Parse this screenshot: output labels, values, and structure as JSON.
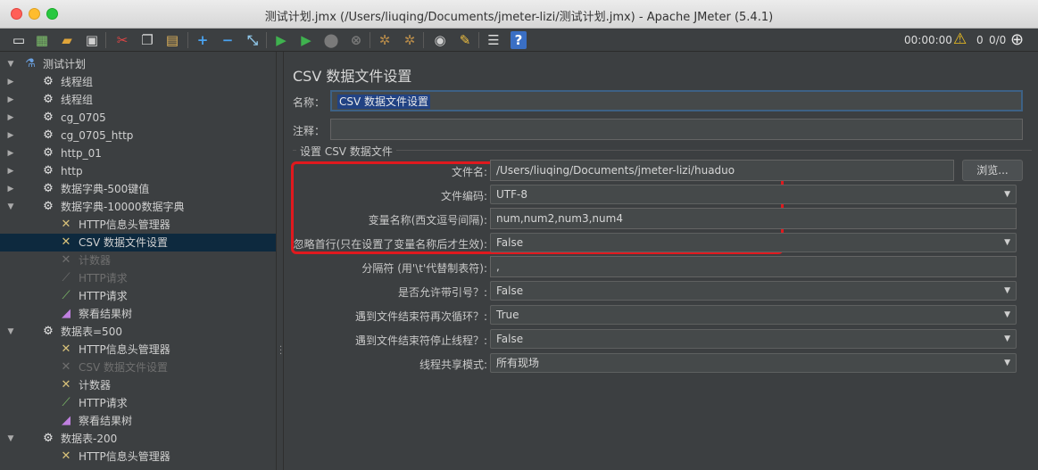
{
  "window": {
    "title": "测试计划.jmx (/Users/liuqing/Documents/jmeter-lizi/测试计划.jmx) - Apache JMeter (5.4.1)"
  },
  "toolbar": {
    "timer": "00:00:00",
    "warnings": "0",
    "threads": "0/0"
  },
  "tree": {
    "root": "测试计划",
    "nodes": [
      {
        "label": "线程组",
        "icon": "gear-icon"
      },
      {
        "label": "线程组",
        "icon": "gear-icon"
      },
      {
        "label": "cg_0705",
        "icon": "gear-icon"
      },
      {
        "label": "cg_0705_http",
        "icon": "gear-icon"
      },
      {
        "label": "http_01",
        "icon": "gear-icon"
      },
      {
        "label": "http",
        "icon": "gear-icon"
      },
      {
        "label": "数据字典-500键值",
        "icon": "gear-icon"
      },
      {
        "label": "数据字典-10000数据字典",
        "icon": "gear-icon"
      },
      {
        "label": "HTTP信息头管理器",
        "icon": "wrench-icon"
      },
      {
        "label": "CSV 数据文件设置",
        "icon": "wrench-icon"
      },
      {
        "label": "计数器",
        "icon": "wrench-icon"
      },
      {
        "label": "HTTP请求",
        "icon": "pipette-icon"
      },
      {
        "label": "HTTP请求",
        "icon": "pipette-icon"
      },
      {
        "label": "察看结果树",
        "icon": "chart-icon"
      },
      {
        "label": "数据表=500",
        "icon": "gear-icon"
      },
      {
        "label": "HTTP信息头管理器",
        "icon": "wrench-icon"
      },
      {
        "label": "CSV 数据文件设置",
        "icon": "wrench-icon"
      },
      {
        "label": "计数器",
        "icon": "wrench-icon"
      },
      {
        "label": "HTTP请求",
        "icon": "pipette-icon"
      },
      {
        "label": "察看结果树",
        "icon": "chart-icon"
      },
      {
        "label": "数据表-200",
        "icon": "gear-icon"
      },
      {
        "label": "HTTP信息头管理器",
        "icon": "wrench-icon"
      }
    ]
  },
  "panel": {
    "title": "CSV 数据文件设置",
    "name_label": "名称：",
    "name_value": "CSV 数据文件设置",
    "comment_label": "注释：",
    "comment_value": "",
    "group_label": "设置 CSV 数据文件",
    "filename_label": "文件名:",
    "filename_value": "/Users/liuqing/Documents/jmeter-lizi/huaduo",
    "browse_label": "浏览...",
    "encoding_label": "文件编码:",
    "encoding_value": "UTF-8",
    "varnames_label": "变量名称(西文逗号间隔):",
    "varnames_value": "num,num2,num3,num4",
    "ignore_label": "忽略首行(只在设置了变量名称后才生效):",
    "ignore_value": "False",
    "delimiter_label": "分隔符 (用'\\t'代替制表符):",
    "delimiter_value": ",",
    "quoted_label": "是否允许带引号？:",
    "quoted_value": "False",
    "recycle_label": "遇到文件结束符再次循环？:",
    "recycle_value": "True",
    "stop_label": "遇到文件结束符停止线程？:",
    "stop_value": "False",
    "share_label": "线程共享模式:",
    "share_value": "所有现场"
  }
}
